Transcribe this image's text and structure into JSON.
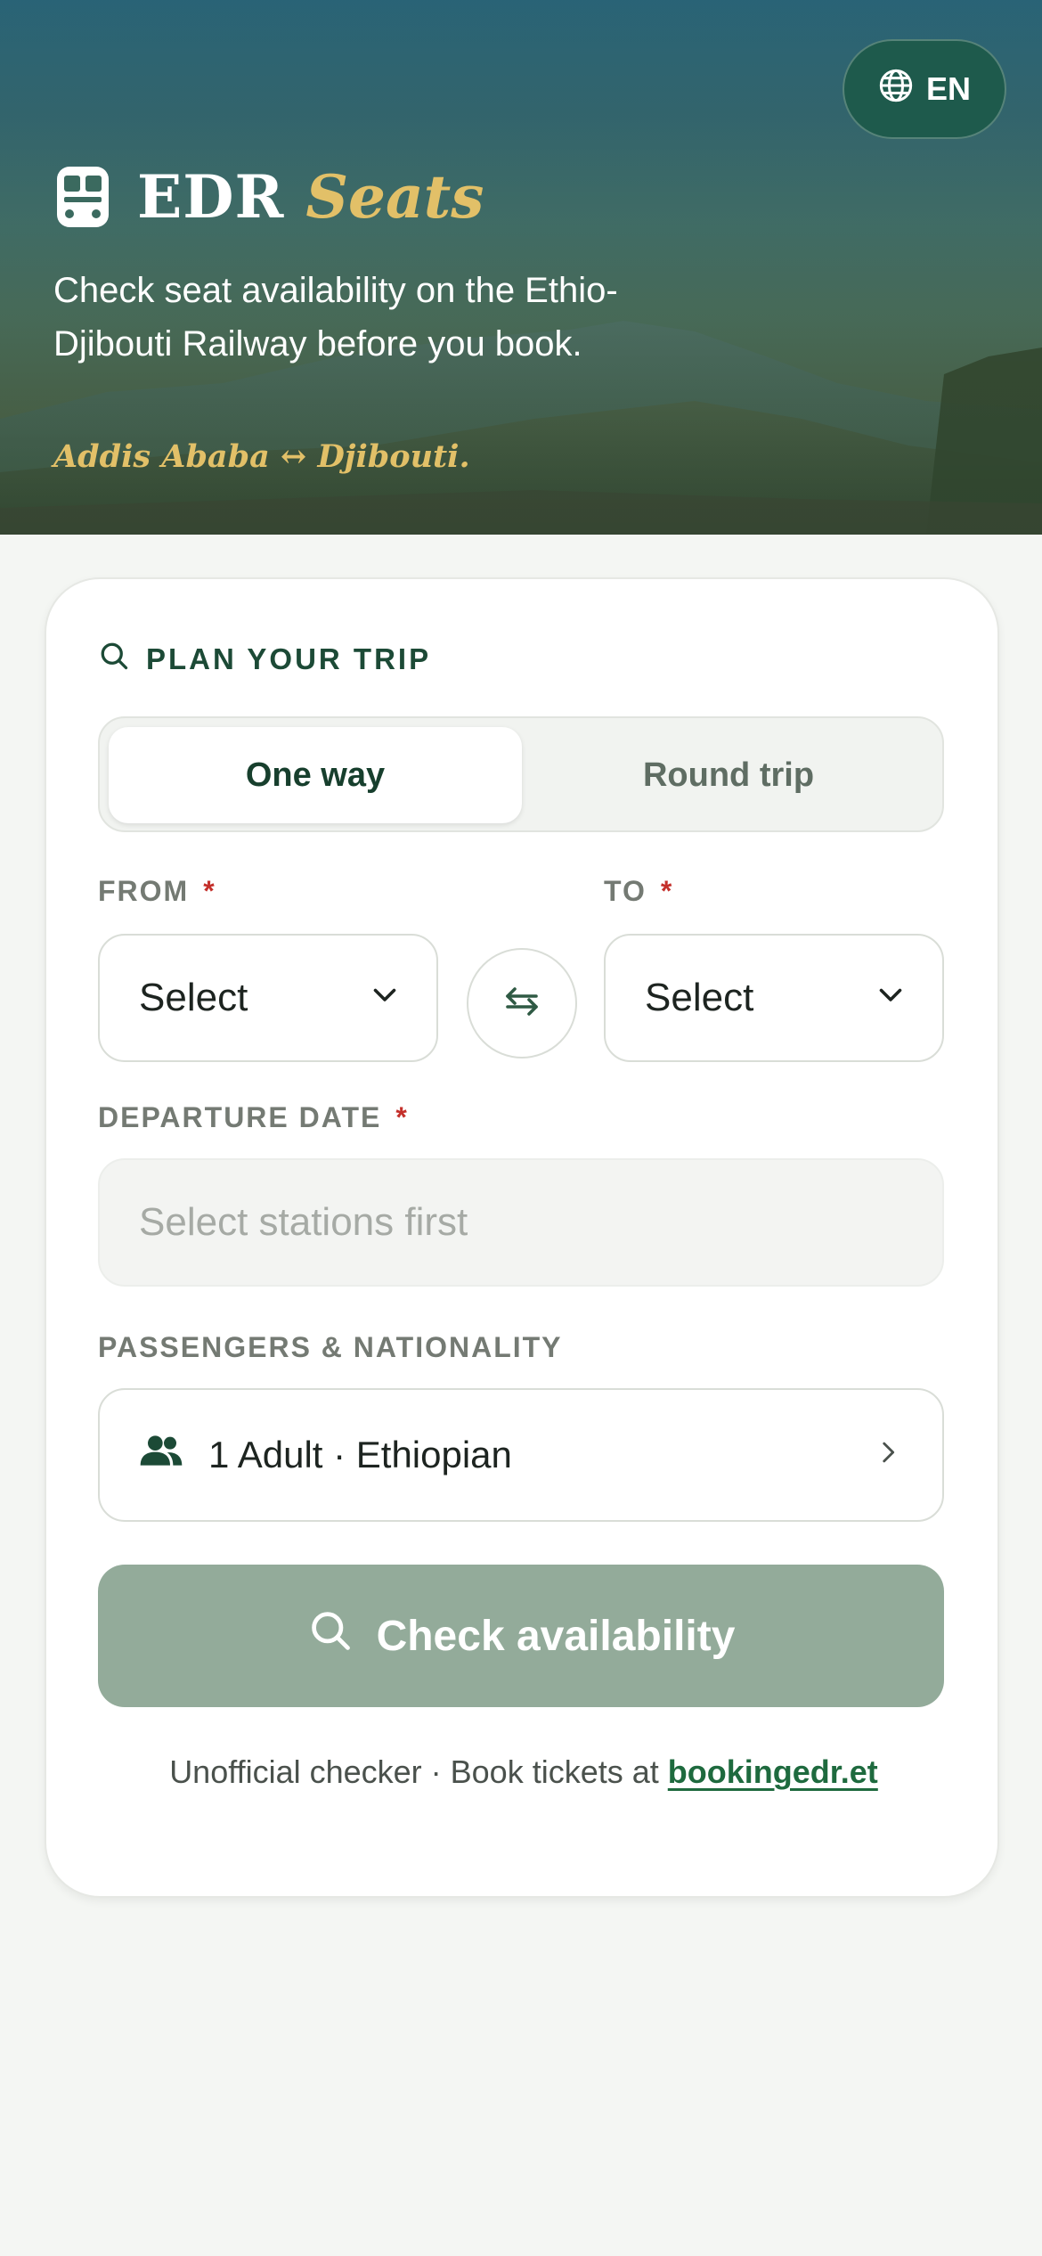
{
  "header": {
    "language_label": "EN",
    "brand_primary": "EDR",
    "brand_secondary": "Seats",
    "tagline": "Check seat availability on the Ethio-Djibouti Railway before you book.",
    "route": "Addis Ababa ↔ Djibouti."
  },
  "form": {
    "section_title": "PLAN YOUR TRIP",
    "trip_types": [
      "One way",
      "Round trip"
    ],
    "selected_trip_type": "One way",
    "from_label": "FROM",
    "from_value": "Select",
    "to_label": "TO",
    "to_value": "Select",
    "required_mark": "*",
    "departure_label": "DEPARTURE DATE",
    "departure_placeholder": "Select stations first",
    "passengers_label": "PASSENGERS & NATIONALITY",
    "passengers_value": "1 Adult · Ethiopian",
    "submit_label": "Check availability"
  },
  "footer": {
    "text": "Unofficial checker · Book tickets at",
    "link_text": "bookingedr.et"
  },
  "colors": {
    "brand_green": "#1c4a36",
    "accent_gold": "#e2c068",
    "required_red": "#c4302b",
    "button_disabled": "#93ab9a"
  }
}
